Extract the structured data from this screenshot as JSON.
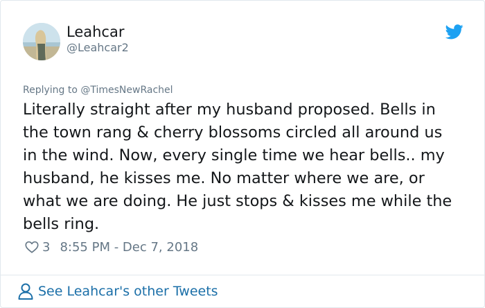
{
  "tweet": {
    "author": {
      "display_name": "Leahcar",
      "handle": "@Leahcar2",
      "avatar_icon": "profile-photo"
    },
    "logo_icon": "twitter-bird-icon",
    "replying_to": "Replying to @TimesNewRachel",
    "text": "Literally straight after my husband proposed. Bells in the town rang & cherry blossoms circled all around us in the wind. Now, every single time we hear bells.. my husband, he kisses me. No matter where we are, or what we are doing. He just stops & kisses me while the bells ring.",
    "like_count": "3",
    "timestamp": "8:55 PM - Dec 7, 2018",
    "footer_link": "See Leahcar's other Tweets"
  },
  "colors": {
    "brand": "#1da1f2",
    "text": "#14171a",
    "secondary": "#657786",
    "link": "#1b6fa8",
    "border": "#e1e8ed"
  }
}
